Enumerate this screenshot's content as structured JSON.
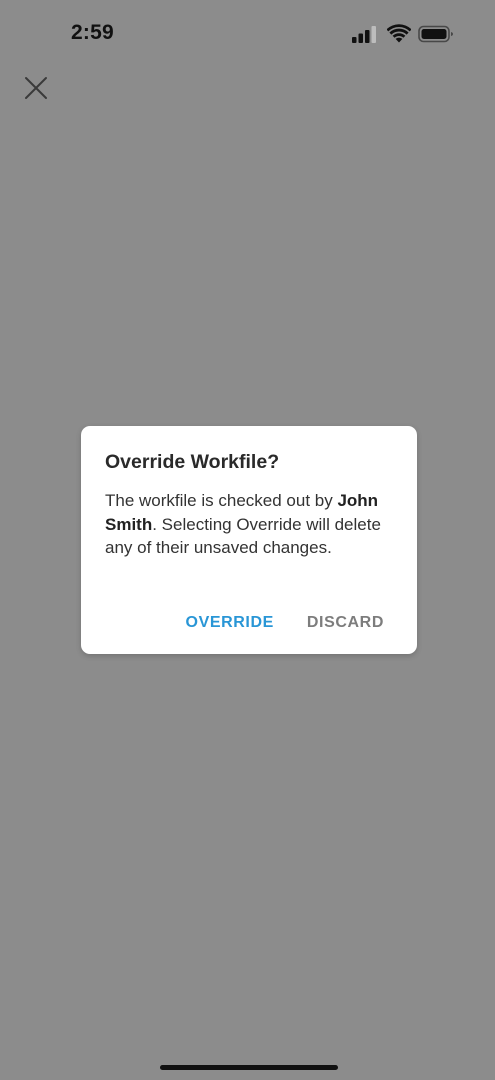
{
  "status_bar": {
    "time": "2:59"
  },
  "colors": {
    "overlay": "#8c8c8c",
    "dialog_background": "#ffffff",
    "override_accent": "#2996d6",
    "discard_text": "#7d7d7d"
  },
  "icons": {
    "close": "close-icon",
    "signal": "cellular-signal-icon",
    "wifi": "wifi-icon",
    "battery": "battery-icon"
  },
  "dialog": {
    "title": "Override Workfile?",
    "message_prefix": "The workfile is checked out by ",
    "message_user": "John Smith",
    "message_suffix": ". Selecting Override will delete any of their unsaved changes.",
    "override_label": "OVERRIDE",
    "discard_label": "DISCARD"
  }
}
